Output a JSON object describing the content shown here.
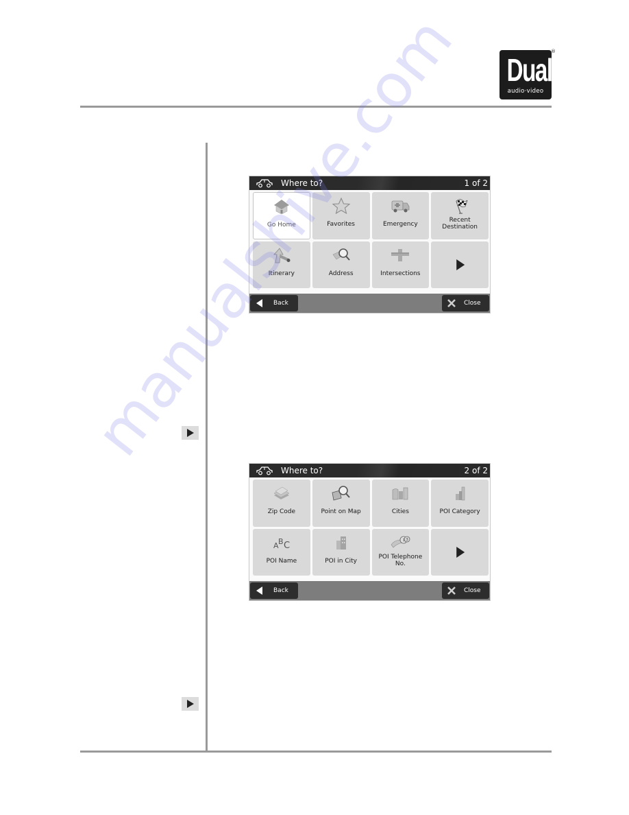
{
  "logo": {
    "brand": "Dual",
    "subtitle": "audio·video",
    "registered_mark": "®"
  },
  "side_markers": [
    {
      "icon": "play-arrow-icon"
    },
    {
      "icon": "play-arrow-icon"
    }
  ],
  "screens": [
    {
      "title": "Where to?",
      "page_indicator": "1 of 2",
      "title_icon": "car-icon",
      "tiles": [
        {
          "label": "Go Home",
          "icon": "home-icon",
          "selected": true
        },
        {
          "label": "Favorites",
          "icon": "star-icon"
        },
        {
          "label": "Emergency",
          "icon": "ambulance-icon"
        },
        {
          "label_line1": "Recent",
          "label_line2": "Destination",
          "icon": "checkered-flag-icon"
        },
        {
          "label": "Itinerary",
          "icon": "itinerary-icon"
        },
        {
          "label": "Address",
          "icon": "address-search-icon"
        },
        {
          "label": "Intersections",
          "icon": "intersection-icon"
        },
        {
          "label": "",
          "icon": "next-page-arrow-icon"
        }
      ],
      "back_label": "Back",
      "close_label": "Close"
    },
    {
      "title": "Where to?",
      "page_indicator": "2 of 2",
      "title_icon": "car-icon",
      "tiles": [
        {
          "label": "Zip Code",
          "icon": "zip-code-icon"
        },
        {
          "label": "Point on Map",
          "icon": "map-search-icon"
        },
        {
          "label": "Cities",
          "icon": "cities-icon"
        },
        {
          "label": "POI Category",
          "icon": "poi-category-icon"
        },
        {
          "label": "POI Name",
          "icon": "abc-icon",
          "icon_text": "ABC"
        },
        {
          "label": "POI in City",
          "icon": "city-building-icon"
        },
        {
          "label_line1": "POI Telephone",
          "label_line2": "No.",
          "icon": "telephone-icon"
        },
        {
          "label": "",
          "icon": "next-page-arrow-icon"
        }
      ],
      "back_label": "Back",
      "close_label": "Close"
    }
  ],
  "watermark": "manualshive.com",
  "colors": {
    "rule": "#9a9a9a",
    "titlebar": "#2b2b2b",
    "tile": "#d9d9d9",
    "bottombar": "#7d7d7d",
    "button": "#2d2d2d"
  }
}
